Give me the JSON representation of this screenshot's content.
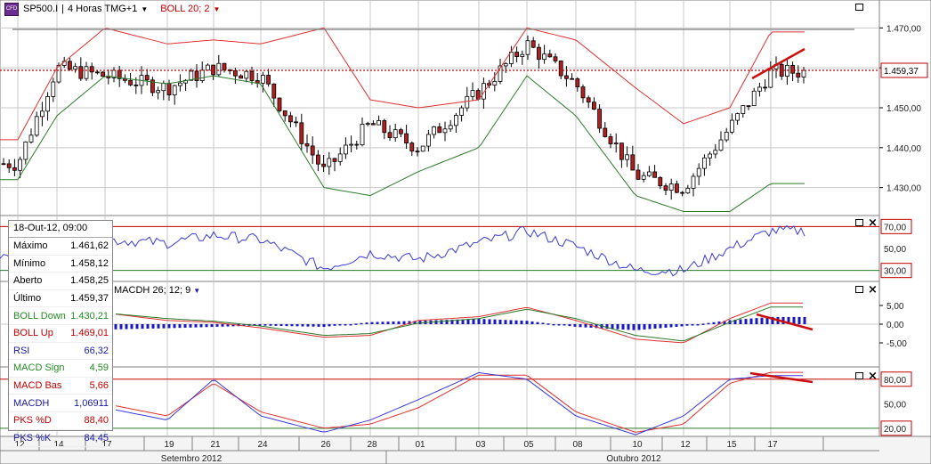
{
  "header": {
    "app_icon": "cfd-app-icon",
    "symbol": "SP500.I",
    "timeframe": "4 Horas TMG+1",
    "indicator": "BOLL 20; 2"
  },
  "price_axis": {
    "ticks": [
      "1.470,00",
      "1.460,00",
      "1.450,00",
      "1.440,00",
      "1.430,00"
    ],
    "current_price": "1.459,37"
  },
  "rsi_axis": {
    "ticks": [
      "70,00",
      "50,00",
      "30,00"
    ]
  },
  "macd": {
    "label": "MACDH 26; 12; 9",
    "ticks": [
      "5,00",
      "0,00",
      "-5,00"
    ]
  },
  "stoch_axis": {
    "ticks": [
      "80,00",
      "50,00",
      "20,00"
    ]
  },
  "x_axis": {
    "days": [
      "12",
      "14",
      "17",
      "19",
      "21",
      "24",
      "26",
      "28",
      "01",
      "03",
      "05",
      "08",
      "10",
      "12",
      "15",
      "17"
    ],
    "months": [
      "Setembro 2012",
      "Outubro 2012"
    ]
  },
  "info": {
    "date": "18-Out-12, 09:00",
    "rows": [
      {
        "label": "Máximo",
        "value": "1.461,62",
        "color": "black"
      },
      {
        "label": "Mínimo",
        "value": "1.458,12",
        "color": "black"
      },
      {
        "label": "Aberto",
        "value": "1.458,25",
        "color": "black"
      },
      {
        "label": "Último",
        "value": "1.459,37",
        "color": "black"
      },
      {
        "label": "BOLL Down",
        "value": "1.430,21",
        "color": "green"
      },
      {
        "label": "BOLL Up",
        "value": "1.469,01",
        "color": "red"
      },
      {
        "label": "RSI",
        "value": "66,32",
        "color": "blue"
      },
      {
        "label": "MACD Sign",
        "value": "4,59",
        "color": "green"
      },
      {
        "label": "MACD Bas",
        "value": "5,66",
        "color": "red"
      },
      {
        "label": "MACDH",
        "value": "1,06911",
        "color": "blue"
      },
      {
        "label": "PKS %D",
        "value": "88,40",
        "color": "red"
      },
      {
        "label": "PKS %K",
        "value": "84,45",
        "color": "blue"
      }
    ]
  },
  "colors": {
    "up": "#ffffff",
    "down": "#b02020",
    "wick": "#000000",
    "boll_up": "#e03030",
    "boll_down": "#2a7a2a",
    "rsi": "#3a3ad8",
    "macd_bar": "#1a1ab8",
    "pks_d": "#e03030",
    "pks_k": "#3a3ad8",
    "trend": "#cc1010",
    "level": "#c00000",
    "grid": "#c8c8c8"
  },
  "chart_data": [
    {
      "type": "candlestick",
      "title": "SP500.I 4 Horas TMG+1",
      "ylim": [
        1423,
        1477
      ],
      "x": [
        "12",
        "14",
        "17",
        "19",
        "21",
        "24",
        "26",
        "28",
        "01",
        "03",
        "05",
        "08",
        "10",
        "12",
        "15",
        "17"
      ],
      "series": [
        {
          "name": "BOLL Up",
          "values": [
            1442,
            1460,
            1470,
            1466,
            1467,
            1466,
            1470,
            1452,
            1450,
            1452,
            1470,
            1467,
            1455,
            1446,
            1450,
            1469
          ]
        },
        {
          "name": "BOLL Down",
          "values": [
            1432,
            1448,
            1458,
            1456,
            1458,
            1456,
            1430,
            1428,
            1434,
            1440,
            1458,
            1448,
            1428,
            1424,
            1424,
            1431
          ]
        }
      ],
      "close": [
        1436,
        1460,
        1458,
        1455,
        1460,
        1458,
        1434,
        1446,
        1440,
        1454,
        1466,
        1456,
        1433,
        1430,
        1445,
        1459
      ],
      "last": 1459.37
    },
    {
      "type": "line",
      "title": "RSI",
      "ylim": [
        20,
        80
      ],
      "x": [
        "12",
        "14",
        "17",
        "19",
        "21",
        "24",
        "26",
        "28",
        "01",
        "03",
        "05",
        "08",
        "10",
        "12",
        "15",
        "17"
      ],
      "series": [
        {
          "name": "RSI",
          "values": [
            45,
            62,
            58,
            55,
            62,
            58,
            32,
            46,
            40,
            55,
            66,
            52,
            30,
            30,
            50,
            66
          ]
        }
      ]
    },
    {
      "type": "bar",
      "title": "MACDH 26; 12; 9",
      "ylim": [
        -7,
        7
      ],
      "x": [
        "12",
        "14",
        "17",
        "19",
        "21",
        "24",
        "26",
        "28",
        "01",
        "03",
        "05",
        "08",
        "10",
        "12",
        "15",
        "17"
      ],
      "series": [
        {
          "name": "MACDH",
          "values": [
            0,
            -0.5,
            -0.8,
            -0.6,
            -0.4,
            -0.2,
            -0.4,
            0.3,
            0.5,
            0.8,
            0.5,
            -0.4,
            -0.9,
            -0.3,
            0.6,
            1.07
          ]
        },
        {
          "name": "MACD Bas",
          "values": [
            6,
            5,
            3,
            1,
            0.5,
            -1,
            -3.5,
            -3,
            1,
            2,
            4.5,
            1,
            -4,
            -5,
            1.5,
            5.66
          ]
        },
        {
          "name": "MACD Sign",
          "values": [
            5,
            4.5,
            3,
            1.5,
            0.8,
            -0.5,
            -3,
            -2.5,
            0.3,
            1.5,
            4,
            1.5,
            -3,
            -4.5,
            0.5,
            4.59
          ]
        }
      ]
    },
    {
      "type": "line",
      "title": "PKS",
      "ylim": [
        10,
        95
      ],
      "x": [
        "12",
        "14",
        "17",
        "19",
        "21",
        "24",
        "26",
        "28",
        "01",
        "03",
        "05",
        "08",
        "10",
        "12",
        "15",
        "17"
      ],
      "series": [
        {
          "name": "PKS %D",
          "values": [
            30,
            70,
            50,
            35,
            75,
            40,
            20,
            25,
            45,
            85,
            85,
            40,
            15,
            25,
            75,
            88.4
          ]
        },
        {
          "name": "PKS %K",
          "values": [
            25,
            75,
            45,
            30,
            80,
            35,
            15,
            30,
            55,
            88,
            80,
            35,
            12,
            35,
            80,
            84.45
          ]
        }
      ]
    }
  ]
}
